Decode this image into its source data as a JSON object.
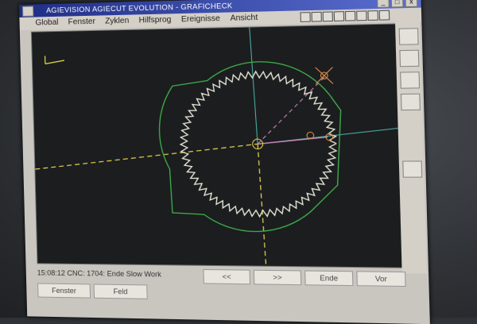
{
  "window": {
    "title": "AGIEVISION AGIECUT EVOLUTION - GRAFICHECK",
    "controls": [
      "_",
      "□",
      "x"
    ]
  },
  "menu": [
    "Global",
    "Fenster",
    "Zyklen",
    "Hilfsprog",
    "Ereignisse",
    "Ansicht"
  ],
  "status": {
    "message": "15:08:12 CNC: 1704: Ende Slow Work"
  },
  "nav_buttons": [
    "<<",
    ">>",
    "Ende",
    "Vor"
  ],
  "softkeys": [
    "Fenster",
    "Feld"
  ],
  "colors": {
    "titlebar": "#1e2d86",
    "gear_profile": "#e8e6d8",
    "contour_green": "#3fae4a",
    "axis_dashed": "#e6d24a",
    "axis_teal": "#4fb0a8",
    "marker_orange": "#e0904a",
    "pink_line": "#d88abf"
  }
}
